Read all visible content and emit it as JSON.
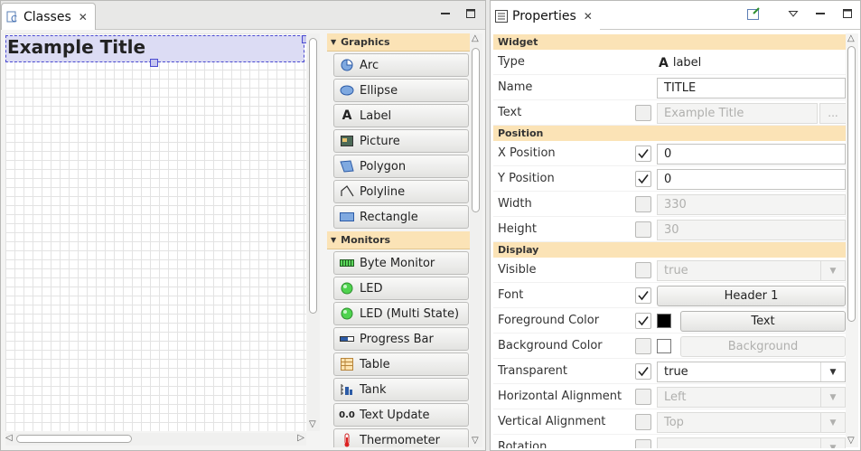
{
  "classes_view": {
    "tab_label": "Classes",
    "canvas": {
      "title_widget_text": "Example Title"
    }
  },
  "palette": {
    "groups": [
      {
        "label": "Graphics",
        "items": [
          {
            "label": "Arc",
            "icon": "arc-icon"
          },
          {
            "label": "Ellipse",
            "icon": "ellipse-icon"
          },
          {
            "label": "Label",
            "icon": "label-icon"
          },
          {
            "label": "Picture",
            "icon": "picture-icon"
          },
          {
            "label": "Polygon",
            "icon": "polygon-icon"
          },
          {
            "label": "Polyline",
            "icon": "polyline-icon"
          },
          {
            "label": "Rectangle",
            "icon": "rectangle-icon"
          }
        ]
      },
      {
        "label": "Monitors",
        "items": [
          {
            "label": "Byte Monitor",
            "icon": "byte-monitor-icon"
          },
          {
            "label": "LED",
            "icon": "led-icon"
          },
          {
            "label": "LED (Multi State)",
            "icon": "led-multi-icon"
          },
          {
            "label": "Progress Bar",
            "icon": "progress-bar-icon"
          },
          {
            "label": "Table",
            "icon": "table-icon"
          },
          {
            "label": "Tank",
            "icon": "tank-icon"
          },
          {
            "label": "Text Update",
            "icon": "text-update-icon",
            "icon_text": "0.0"
          },
          {
            "label": "Thermometer",
            "icon": "thermometer-icon"
          }
        ]
      }
    ]
  },
  "properties_view": {
    "tab_label": "Properties",
    "sections": {
      "widget": "Widget",
      "position": "Position",
      "display": "Display"
    },
    "rows": {
      "type": {
        "name": "Type",
        "value": "label",
        "icon_letter": "A"
      },
      "name": {
        "name": "Name",
        "value": "TITLE"
      },
      "text": {
        "name": "Text",
        "value": "Example Title",
        "button": "..."
      },
      "x": {
        "name": "X Position",
        "value": "0"
      },
      "y": {
        "name": "Y Position",
        "value": "0"
      },
      "width": {
        "name": "Width",
        "value": "330"
      },
      "height": {
        "name": "Height",
        "value": "30"
      },
      "visible": {
        "name": "Visible",
        "value": "true"
      },
      "font": {
        "name": "Font",
        "value": "Header 1"
      },
      "fg": {
        "name": "Foreground Color",
        "value": "Text",
        "swatch_color": "#000000"
      },
      "bg": {
        "name": "Background Color",
        "value": "Background",
        "swatch_color": "#ffffff"
      },
      "transparent": {
        "name": "Transparent",
        "value": "true"
      },
      "halign": {
        "name": "Horizontal Alignment",
        "value": "Left"
      },
      "valign": {
        "name": "Vertical Alignment",
        "value": "Top"
      },
      "rotation": {
        "name": "Rotation"
      }
    }
  },
  "colors": {
    "section_header_bg": "#fbe3b6",
    "selection_bg": "#dcdcf4",
    "selection_border": "#4a4ad0"
  }
}
